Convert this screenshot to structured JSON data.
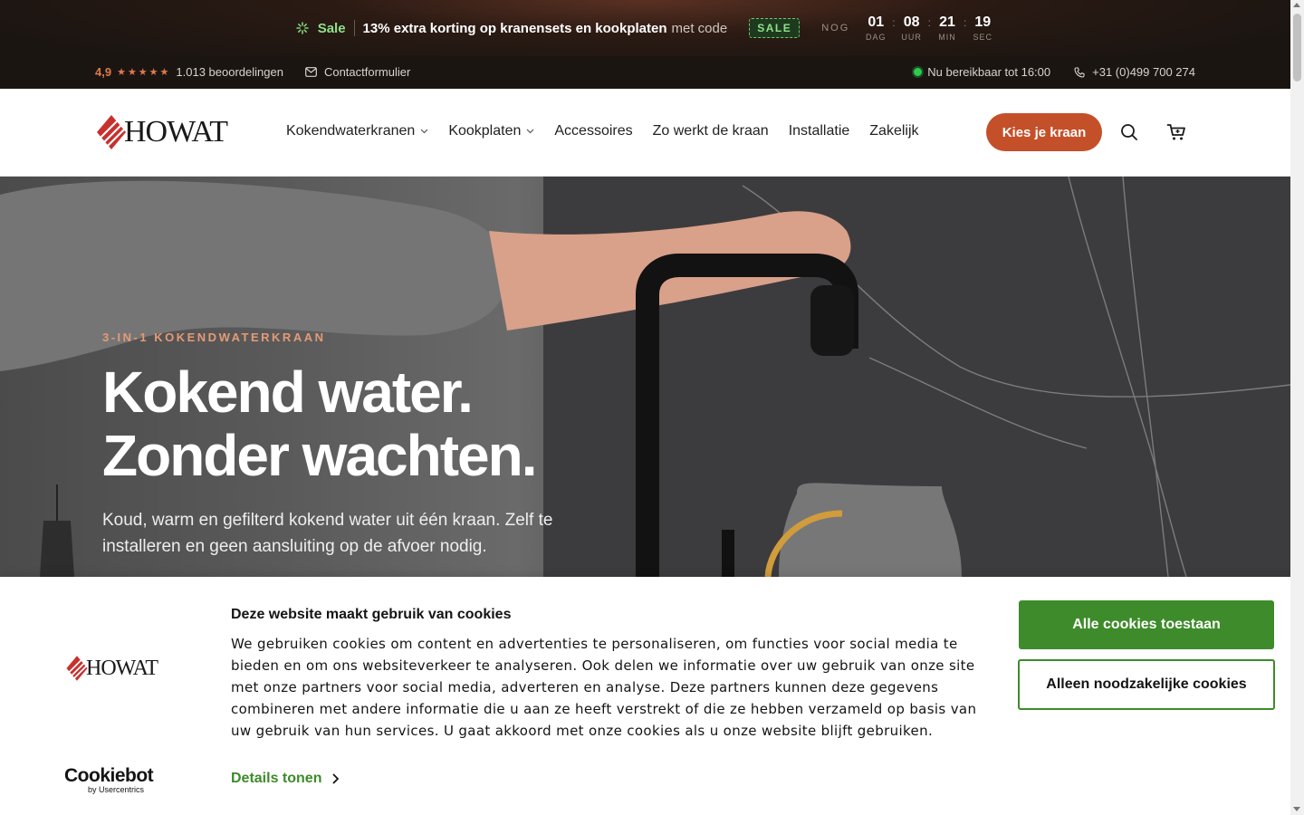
{
  "promo": {
    "sale_label": "Sale",
    "deal_text": "13% extra korting op kranensets en kookplaten",
    "code_prefix": "met code",
    "code": "SALE",
    "countdown_prefix": "NOG",
    "countdown": [
      {
        "value": "01",
        "label": "DAG"
      },
      {
        "value": "08",
        "label": "UUR"
      },
      {
        "value": "21",
        "label": "MIN"
      },
      {
        "value": "19",
        "label": "SEC"
      }
    ]
  },
  "infobar": {
    "rating": "4,9",
    "stars": "★★★★★",
    "reviews": "1.013 beoordelingen",
    "contact_label": "Contactformulier",
    "availability": "Nu bereikbaar tot 16:00",
    "phone": "+31 (0)499 700 274"
  },
  "nav": {
    "logo_text": "HOWAT",
    "items": [
      {
        "label": "Kokendwaterkranen",
        "has_dropdown": true
      },
      {
        "label": "Kookplaten",
        "has_dropdown": true
      },
      {
        "label": "Accessoires",
        "has_dropdown": false
      },
      {
        "label": "Zo werkt de kraan",
        "has_dropdown": false
      },
      {
        "label": "Installatie",
        "has_dropdown": false
      },
      {
        "label": "Zakelijk",
        "has_dropdown": false
      }
    ],
    "cta_label": "Kies je kraan",
    "icons": [
      "search-icon",
      "cart-icon"
    ]
  },
  "hero": {
    "eyebrow": "3-IN-1 KOKENDWATERKRAAN",
    "title_line1": "Kokend water.",
    "title_line2": "Zonder wachten.",
    "subtitle": "Koud, warm en gefilterd kokend water uit één kraan. Zelf te installeren en geen aansluiting op de afvoer nodig."
  },
  "cookie": {
    "logo_text": "HOWAT",
    "title": "Deze website maakt gebruik van cookies",
    "body": "We gebruiken cookies om content en advertenties te personaliseren, om functies voor social media te bieden en om ons websiteverkeer te analyseren. Ook delen we informatie over uw gebruik van onze site met onze partners voor social media, adverteren en analyse. Deze partners kunnen deze gegevens combineren met andere informatie die u aan ze heeft verstrekt of die ze hebben verzameld op basis van uw gebruik van hun services. U gaat akkoord met onze cookies als u onze website blijft gebruiken.",
    "details_label": "Details tonen",
    "accept_all_label": "Alle cookies toestaan",
    "necessary_only_label": "Alleen noodzakelijke cookies",
    "provider_name": "Cookiebot",
    "provider_by": "by Usercentrics"
  },
  "colors": {
    "accent": "#c4502a",
    "cookie_green": "#3d8b2a",
    "sale_green": "#8fe08a",
    "rating_orange": "#e0794a"
  }
}
